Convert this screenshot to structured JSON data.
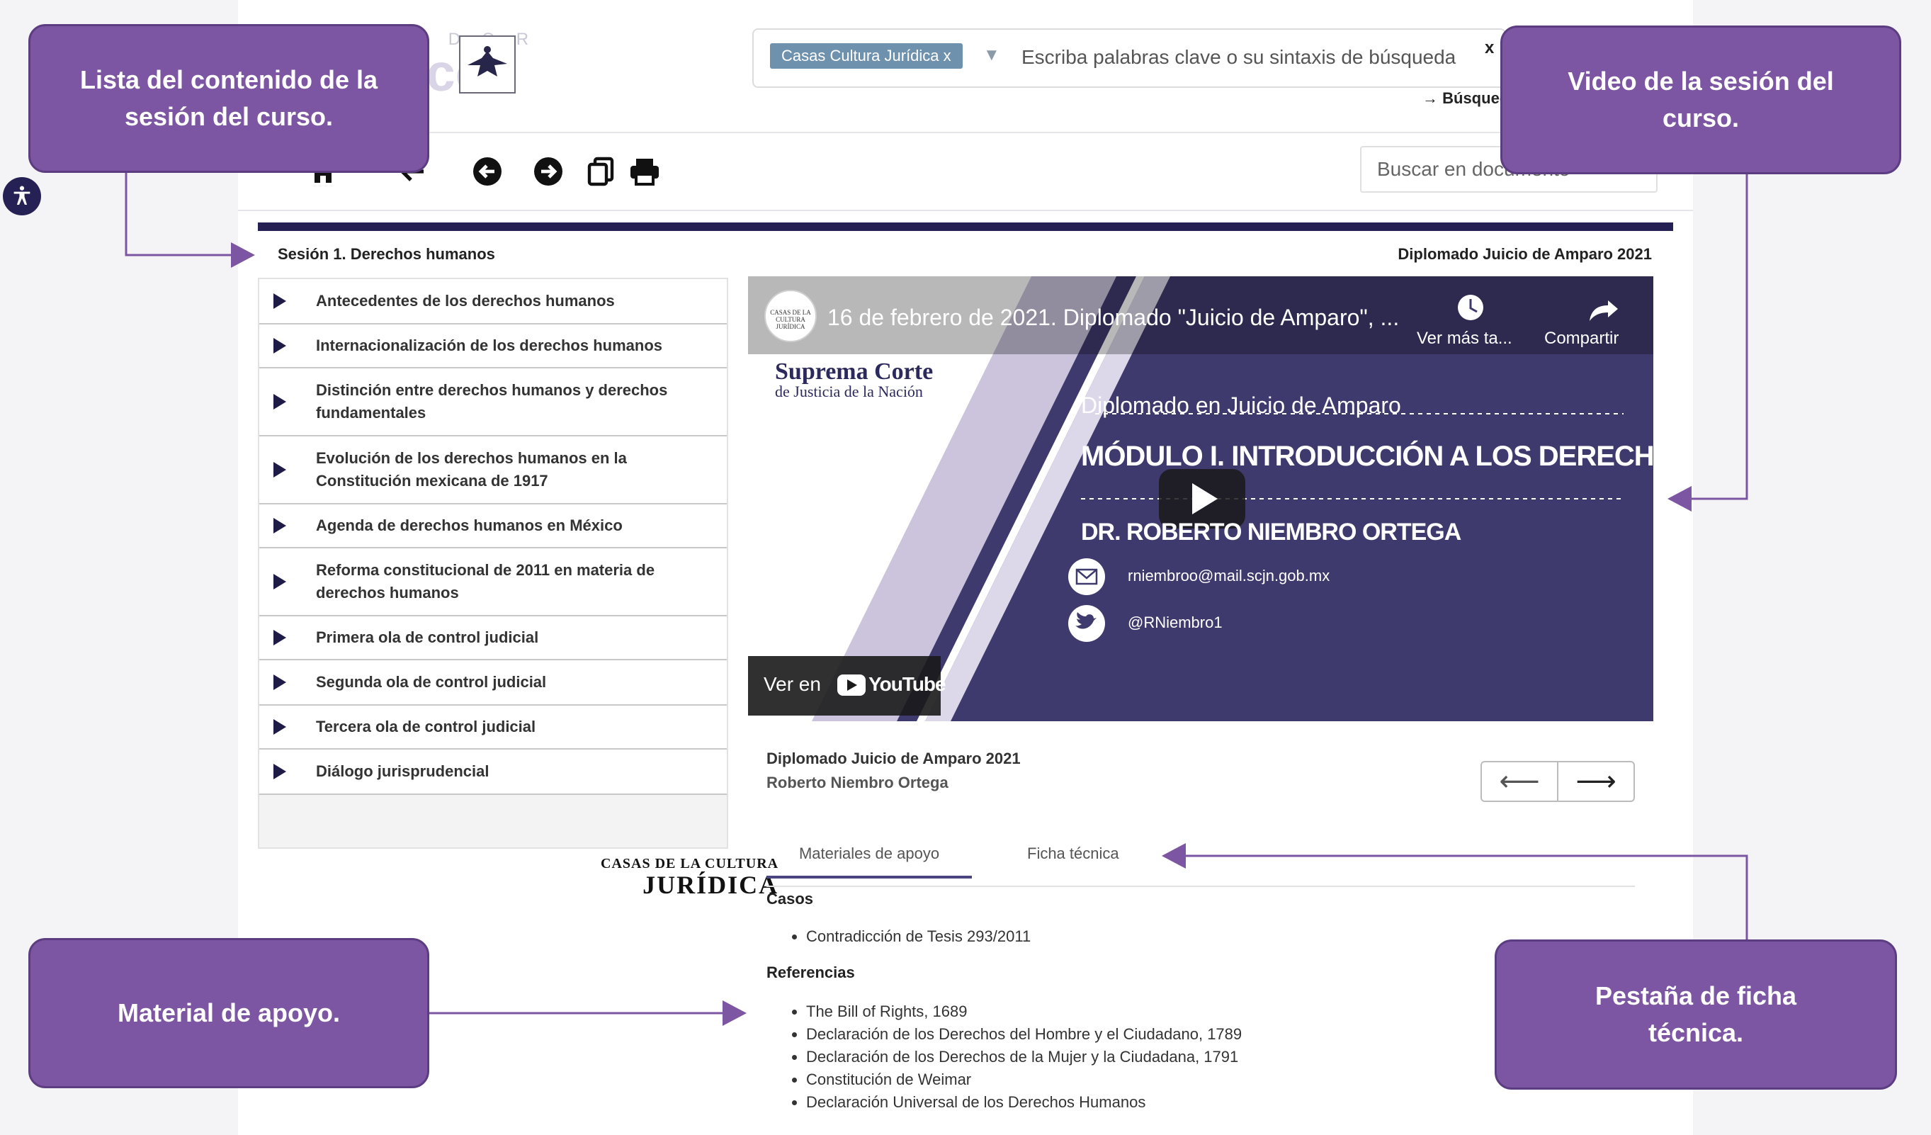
{
  "logo": {
    "top_text": "BUSCADOR",
    "main_text": "Jurídico"
  },
  "search": {
    "chip_label": "Casas Cultura Jurídica",
    "chip_remove": "x",
    "placeholder": "Escriba palabras clave o su sintaxis de búsqueda",
    "clear_label": "x",
    "advanced_arrow": "→",
    "advanced_label": "Búsqueda avanzada"
  },
  "toolbar": {
    "doc_search_placeholder": "Buscar en documento"
  },
  "header": {
    "session_title": "Sesión 1. Derechos humanos",
    "course_title": "Diplomado Juicio de Amparo 2021"
  },
  "session_list": [
    "Antecedentes de los derechos humanos",
    "Internacionalización de los derechos humanos",
    "Distinción entre derechos humanos y derechos fundamentales",
    "Evolución de los derechos humanos en la Constitución mexicana de 1917",
    "Agenda de derechos humanos en México",
    "Reforma constitucional de 2011 en materia de derechos humanos",
    "Primera ola de control judicial",
    "Segunda ola de control judicial",
    "Tercera ola de control judicial",
    "Diálogo jurisprudencial"
  ],
  "casas_logo": {
    "line1": "CASAS DE LA CULTURA",
    "line2": "JURÍDICA"
  },
  "video": {
    "title": "16 de febrero de 2021. Diplomado \"Juicio de Amparo\", ...",
    "watch_later": "Ver más ta...",
    "share": "Compartir",
    "channel_line1": "Suprema Corte",
    "channel_line2": "de Justicia de la Nación",
    "badge_text": "CASAS DE LA CULTURA JURÍDICA",
    "diploma": "Diplomado en Juicio de Amparo",
    "module": "MÓDULO I. INTRODUCCIÓN A LOS DERECHOS HUMANOS",
    "speaker": "DR. ROBERTO NIEMBRO ORTEGA",
    "email": "rniembroo@mail.scjn.gob.mx",
    "twitter": "@RNiembro1",
    "watch_on": "Ver en",
    "youtube": "YouTube"
  },
  "content": {
    "title": "Diplomado Juicio de Amparo 2021",
    "author": "Roberto Niembro Ortega",
    "prev": "⟵",
    "next": "⟶",
    "tabs": [
      "Materiales de apoyo",
      "Ficha técnica"
    ],
    "cases_heading": "Casos",
    "cases": [
      "Contradicción de Tesis 293/2011"
    ],
    "refs_heading": "Referencias",
    "references": [
      "The Bill of Rights, 1689",
      "Declaración de los Derechos del Hombre y el Ciudadano, 1789",
      "Declaración de los Derechos de la Mujer y la Ciudadana, 1791",
      "Constitución de Weimar",
      "Declaración Universal de los Derechos Humanos"
    ]
  },
  "callouts": {
    "list": "Lista del contenido de la sesión del curso.",
    "video": "Video de la sesión del curso.",
    "material": "Material de apoyo.",
    "ficha": "Pestaña de ficha técnica."
  },
  "colors": {
    "accent": "#7c56a2",
    "navy": "#262155",
    "chip": "#6e91ad",
    "video_bg": "#3f3a6e"
  }
}
